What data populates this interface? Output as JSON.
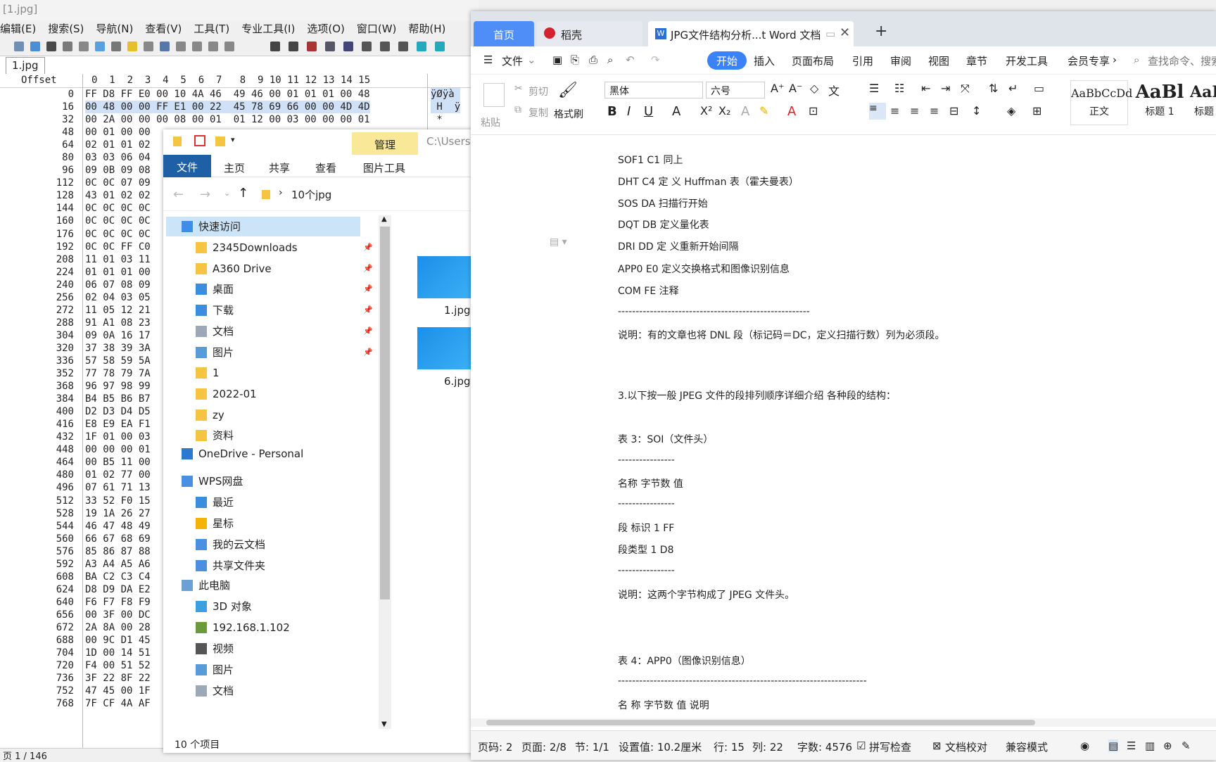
{
  "hex_editor": {
    "title": "[1.jpg]",
    "menu": [
      "编辑(E)",
      "搜索(S)",
      "导航(N)",
      "查看(V)",
      "工具(T)",
      "专业工具(I)",
      "选项(O)",
      "窗口(W)",
      "帮助(H)"
    ],
    "file_tab": "1.jpg",
    "offset_header": "Offset",
    "column_headers": "0  1  2  3  4  5  6  7   8  9 10 11 12 13 14 15",
    "rows": [
      {
        "offset": "0",
        "hex": "FF D8 FF E0 00 10 4A 46  49 46 00 01 01 01 00 48",
        "text": "ÿØÿà"
      },
      {
        "offset": "16",
        "hex": "00 48 00 00 FF E1 00 22  45 78 69 66 00 00 4D 4D",
        "text": " H  ÿ"
      },
      {
        "offset": "32",
        "hex": "00 2A 00 00 00 08 00 01  01 12 00 03 00 00 00 01",
        "text": " *"
      },
      {
        "offset": "48",
        "hex": "00 01 00 00",
        "text": ""
      },
      {
        "offset": "64",
        "hex": "02 01 01 02",
        "text": ""
      },
      {
        "offset": "80",
        "hex": "03 03 06 04",
        "text": ""
      },
      {
        "offset": "96",
        "hex": "09 0B 09 08",
        "text": ""
      },
      {
        "offset": "112",
        "hex": "0C 0C 07 09",
        "text": ""
      },
      {
        "offset": "128",
        "hex": "43 01 02 02",
        "text": ""
      },
      {
        "offset": "144",
        "hex": "0C 0C 0C 0C",
        "text": ""
      },
      {
        "offset": "160",
        "hex": "0C 0C 0C 0C",
        "text": ""
      },
      {
        "offset": "176",
        "hex": "0C 0C 0C 0C",
        "text": ""
      },
      {
        "offset": "192",
        "hex": "0C 0C FF C0",
        "text": ""
      },
      {
        "offset": "208",
        "hex": "11 01 03 11",
        "text": ""
      },
      {
        "offset": "224",
        "hex": "01 01 01 00",
        "text": ""
      },
      {
        "offset": "240",
        "hex": "06 07 08 09",
        "text": ""
      },
      {
        "offset": "256",
        "hex": "02 04 03 05",
        "text": ""
      },
      {
        "offset": "272",
        "hex": "11 05 12 21",
        "text": ""
      },
      {
        "offset": "288",
        "hex": "91 A1 08 23",
        "text": ""
      },
      {
        "offset": "304",
        "hex": "09 0A 16 17",
        "text": ""
      },
      {
        "offset": "320",
        "hex": "37 38 39 3A",
        "text": ""
      },
      {
        "offset": "336",
        "hex": "57 58 59 5A",
        "text": ""
      },
      {
        "offset": "352",
        "hex": "77 78 79 7A",
        "text": ""
      },
      {
        "offset": "368",
        "hex": "96 97 98 99",
        "text": ""
      },
      {
        "offset": "384",
        "hex": "B4 B5 B6 B7",
        "text": ""
      },
      {
        "offset": "400",
        "hex": "D2 D3 D4 D5",
        "text": ""
      },
      {
        "offset": "416",
        "hex": "E8 E9 EA F1",
        "text": ""
      },
      {
        "offset": "432",
        "hex": "1F 01 00 03",
        "text": ""
      },
      {
        "offset": "448",
        "hex": "00 00 00 01",
        "text": ""
      },
      {
        "offset": "464",
        "hex": "00 B5 11 00",
        "text": ""
      },
      {
        "offset": "480",
        "hex": "01 02 77 00",
        "text": ""
      },
      {
        "offset": "496",
        "hex": "07 61 71 13",
        "text": ""
      },
      {
        "offset": "512",
        "hex": "33 52 F0 15",
        "text": ""
      },
      {
        "offset": "528",
        "hex": "19 1A 26 27",
        "text": ""
      },
      {
        "offset": "544",
        "hex": "46 47 48 49",
        "text": ""
      },
      {
        "offset": "560",
        "hex": "66 67 68 69",
        "text": ""
      },
      {
        "offset": "576",
        "hex": "85 86 87 88",
        "text": ""
      },
      {
        "offset": "592",
        "hex": "A3 A4 A5 A6",
        "text": ""
      },
      {
        "offset": "608",
        "hex": "BA C2 C3 C4",
        "text": ""
      },
      {
        "offset": "624",
        "hex": "D8 D9 DA E2",
        "text": ""
      },
      {
        "offset": "640",
        "hex": "F6 F7 F8 F9",
        "text": ""
      },
      {
        "offset": "656",
        "hex": "00 3F 00 DC",
        "text": ""
      },
      {
        "offset": "672",
        "hex": "2A 8A 00 28",
        "text": ""
      },
      {
        "offset": "688",
        "hex": "00 9C D1 45",
        "text": ""
      },
      {
        "offset": "704",
        "hex": "1D 00 14 51",
        "text": ""
      },
      {
        "offset": "720",
        "hex": "F4 00 51 52",
        "text": ""
      },
      {
        "offset": "736",
        "hex": "3F 22 8F 22",
        "text": ""
      },
      {
        "offset": "752",
        "hex": "47 45 00 1F",
        "text": ""
      },
      {
        "offset": "768",
        "hex": "7F CF 4A AF",
        "text": ""
      }
    ],
    "status": "页 1 / 146"
  },
  "explorer": {
    "ribbon_tabs": [
      "文件",
      "主页",
      "共享",
      "查看",
      "图片工具"
    ],
    "manage": "管理",
    "path_hint": "C:\\Users\\",
    "address": "10个jpg",
    "quick_access": "快速访问",
    "nav": [
      {
        "label": "2345Downloads",
        "icon": "folder-icon",
        "pin": true
      },
      {
        "label": "A360 Drive",
        "icon": "folder-icon",
        "pin": true
      },
      {
        "label": "桌面",
        "icon": "desktop-icon",
        "pin": true
      },
      {
        "label": "下载",
        "icon": "download-icon",
        "pin": true
      },
      {
        "label": "文档",
        "icon": "document-icon",
        "pin": true
      },
      {
        "label": "图片",
        "icon": "picture-icon",
        "pin": true
      },
      {
        "label": "1",
        "icon": "folder-icon",
        "pin": false
      },
      {
        "label": "2022-01",
        "icon": "folder-icon",
        "pin": false
      },
      {
        "label": "zy",
        "icon": "folder-icon",
        "pin": false
      },
      {
        "label": "资料",
        "icon": "folder-icon",
        "pin": false
      }
    ],
    "onedrive": "OneDrive - Personal",
    "wps_drive": "WPS网盘",
    "wps_items": [
      "最近",
      "星标",
      "我的云文档",
      "共享文件夹"
    ],
    "this_pc": "此电脑",
    "pc_items": [
      "3D 对象",
      "192.168.1.102",
      "视频",
      "图片",
      "文档"
    ],
    "files": [
      "1.jpg",
      "6.jpg"
    ],
    "status": "10 个项目"
  },
  "wps": {
    "tab_home": "首页",
    "tab_daoke": "稻壳",
    "tab_doc": "JPG文件结构分析...t Word 文档",
    "menu_file": "文件",
    "menu": [
      "开始",
      "插入",
      "页面布局",
      "引用",
      "审阅",
      "视图",
      "章节",
      "开发工具",
      "会员专享"
    ],
    "search": "查找命令、搜索",
    "ribbon": {
      "paste": "粘贴",
      "cut": "剪切",
      "copy": "复制",
      "format_painter": "格式刷",
      "font": "黑体",
      "size": "六号",
      "styles": [
        {
          "preview": "AaBbCcDd",
          "name": "正文"
        },
        {
          "preview": "AaBl",
          "name": "标题 1"
        },
        {
          "preview": "AaBl",
          "name": "标题"
        }
      ]
    },
    "doc_lines": [
      "SOF1 C1 同上",
      "DHT C4 定 义 Huffman 表（霍夫曼表）",
      "SOS DA 扫描行开始",
      "DQT DB 定义量化表",
      "DRI DD 定 义重新开始间隔",
      "APP0 E0 定义交换格式和图像识别信息",
      "COM FE 注释",
      "------------------------------------------------------",
      "说明：有的文章也将 DNL 段（标记码＝DC，定义扫描行数）列为必须段。",
      "3.以下按一般 JPEG 文件的段排列顺序详细介绍 各种段的结构：",
      "表 3：SOI（文件头）",
      "----------------",
      "名称  字节数  值",
      "----------------",
      "段  标识  1 FF",
      "段类型  1 D8",
      "----------------",
      "说明：这两个字节构成了 JPEG 文件头。",
      "表 4：APP0（图像识别信息）",
      "----------------------------------------------------------------------",
      "名  称  字节数  值  说明",
      "----------------------------------------------------------------------"
    ],
    "status": {
      "page_code": "页码: 2",
      "pages": "页面: 2/8",
      "section": "节: 1/1",
      "setting": "设置值: 10.2厘米",
      "row": "行: 15",
      "col": "列: 22",
      "words": "字数: 4576",
      "spell": "拼写检查",
      "proof": "文档校对",
      "compat": "兼容模式"
    }
  }
}
